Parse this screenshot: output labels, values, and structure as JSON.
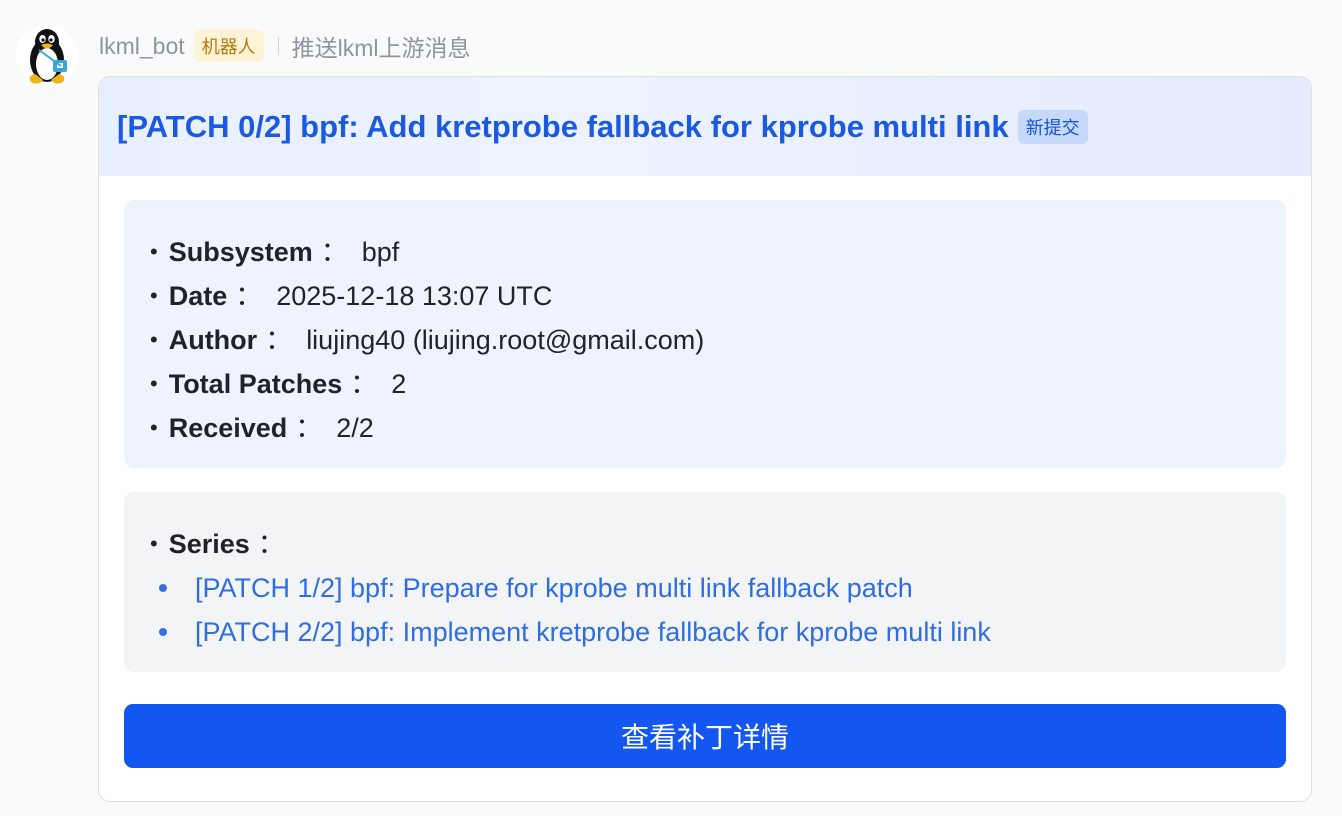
{
  "sender": {
    "name": "lkml_bot",
    "tag": "机器人",
    "description": "推送lkml上游消息",
    "avatar_icon": "tux-penguin-icon"
  },
  "card": {
    "title": "[PATCH 0/2] bpf: Add kretprobe fallback for kprobe multi link",
    "title_tag": "新提交",
    "fields": [
      {
        "key": "Subsystem",
        "value": "bpf"
      },
      {
        "key": "Date",
        "value": "2025-12-18 13:07 UTC"
      },
      {
        "key": "Author",
        "value": "liujing40 (liujing.root@gmail.com)"
      },
      {
        "key": "Total Patches",
        "value": "2"
      },
      {
        "key": "Received",
        "value": "2/2"
      }
    ],
    "separator": "：",
    "series": {
      "label": "Series",
      "items": [
        "[PATCH 1/2] bpf: Prepare for kprobe multi link fallback patch",
        "[PATCH 2/2] bpf: Implement kretprobe fallback for kprobe multi link"
      ]
    },
    "button_label": "查看补丁详情"
  },
  "colors": {
    "accent": "#1456f0",
    "title": "#1b5ae0",
    "link": "#2f6ee0",
    "tag_bg": "#fdf3d7",
    "tag_fg": "#b9780a"
  }
}
